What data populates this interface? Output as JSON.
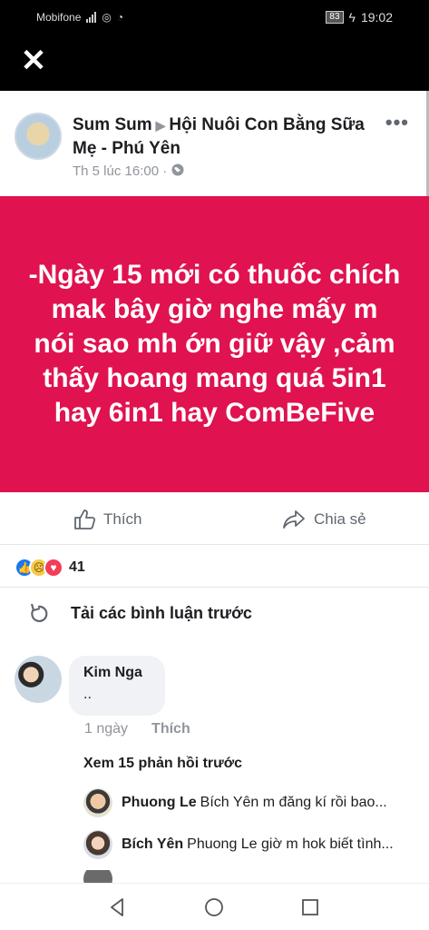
{
  "status_bar": {
    "carrier": "Mobifone",
    "battery": "83",
    "time": "19:02"
  },
  "post": {
    "author": "Sum Sum",
    "group": "Hội Nuôi Con Bằng Sữa Mẹ - Phú Yên",
    "timestamp": "Th 5 lúc 16:00 ·",
    "body": "-Ngày 15 mới có thuốc chích mak bây giờ nghe mấy m nói sao mh ớn giữ vậy ,cảm thấy hoang mang quá 5in1 hay 6in1 hay ComBeFive",
    "body_bg_color": "#e0124f"
  },
  "actions": {
    "like_label": "Thích",
    "share_label": "Chia sẻ"
  },
  "reactions": {
    "count": "41"
  },
  "comments": {
    "load_previous_label": "Tải các bình luận trước",
    "items": [
      {
        "name": "Kim Nga",
        "text": "..",
        "time": "1 ngày",
        "like_label": "Thích"
      }
    ],
    "view_replies_label": "Xem 15 phản hồi trước",
    "replies": [
      {
        "name": "Phuong Le",
        "text": "Bích Yên  m đăng kí rồi bao..."
      },
      {
        "name": "Bích Yên",
        "text": "Phuong Le giờ m hok biết tình..."
      }
    ]
  }
}
